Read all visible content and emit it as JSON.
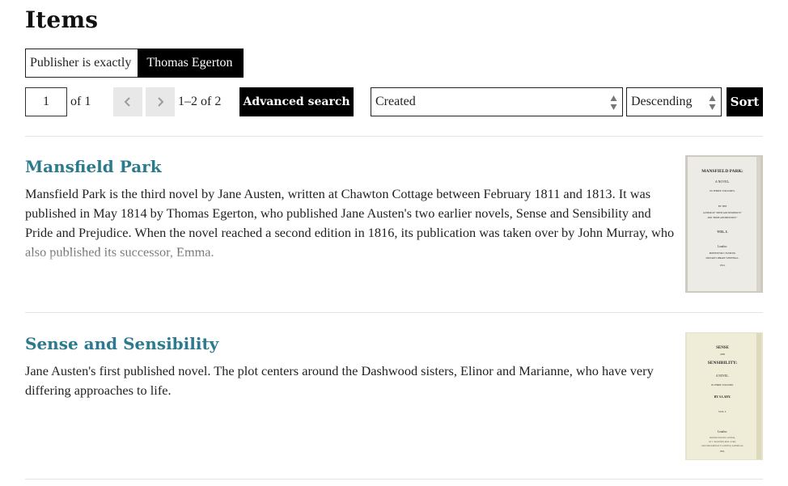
{
  "page": {
    "title": "Items"
  },
  "filter": {
    "field_label": "Publisher is exactly",
    "value": "Thomas Egerton"
  },
  "pagination": {
    "current_page": "1",
    "of_text": "of 1",
    "range_text": "1–2 of 2",
    "prev_icon": "chevron-left-icon",
    "next_icon": "chevron-right-icon"
  },
  "toolbar": {
    "advanced_search_label": "Advanced search",
    "sort_by": "Created",
    "sort_order": "Descending",
    "sort_label": "Sort"
  },
  "colors": {
    "title_link": "#2b7a8e",
    "button_bg": "#000000",
    "pager_bg": "#e8e8e8"
  },
  "items": [
    {
      "title": "Mansfield Park",
      "description": "Mansfield Park is the third novel by Jane Austen, written at Chawton Cottage between February 1811 and 1813. It was published in May 1814 by Thomas Egerton, who published Jane Austen's two earlier novels, Sense and Sensibility and Pride and Prejudice. When the novel reached a second edition in 1816, its publication was taken over by John Murray, who also published its successor, Emma.",
      "thumbnail": {
        "lines": [
          "MANSFIELD PARK:",
          "A NOVEL.",
          "IN THREE VOLUMES.",
          "BY THE",
          "AUTHOR OF \"SENSE AND SENSIBILITY,\"",
          "AND \"PRIDE AND PREJUDICE.\"",
          "VOL. I.",
          "London:",
          "PRINTED FOR T. EGERTON,",
          "MILITARY LIBRARY, WHITEHALL.",
          "1814."
        ]
      }
    },
    {
      "title": "Sense and Sensibility",
      "description": "Jane Austen's first published novel. The plot centers around the Dashwood sisters, Elinor and Marianne, who have very differing approaches to life.",
      "thumbnail": {
        "lines": [
          "SENSE",
          "AND",
          "SENSIBILITY:",
          "A NOVEL.",
          "IN THREE VOLUMES.",
          "BY A LADY.",
          "VOL. I.",
          "London:",
          "PRINTED FOR THE AUTHOR,",
          "BY C. ROWORTH, BELL-YARD,",
          "AND PUBLISHED BY T. EGERTON, WHITEHALL.",
          "1811."
        ]
      }
    }
  ]
}
